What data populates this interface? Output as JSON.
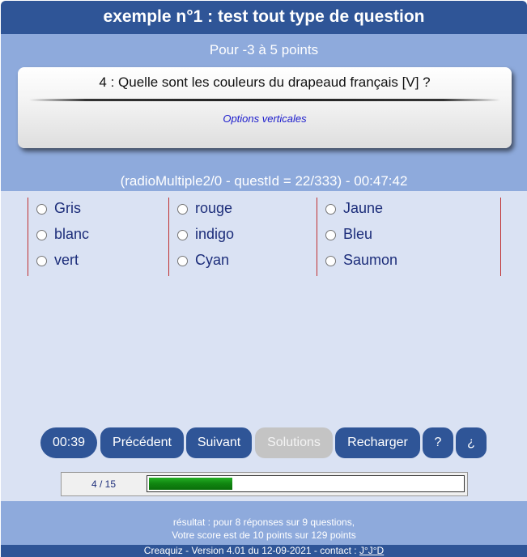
{
  "header": {
    "title": "exemple n°1 : test tout type de question"
  },
  "points": "Pour -3 à 5 points",
  "question": {
    "text": "4 : Quelle sont les couleurs du drapeaud français [V] ?",
    "option_note": "Options verticales"
  },
  "question_info": "(radioMultiple2/0 - questId = 22/333) - 00:47:42",
  "answers": {
    "col1": [
      "Gris",
      "blanc",
      "vert"
    ],
    "col2": [
      "rouge",
      "indigo",
      "Cyan"
    ],
    "col3": [
      "Jaune",
      "Bleu",
      "Saumon"
    ]
  },
  "buttons": {
    "timer": "00:39",
    "previous": "Précédent",
    "next": "Suivant",
    "solutions": "Solutions",
    "reload": "Recharger",
    "help": "?",
    "about": "¿"
  },
  "progress": {
    "label": "4 / 15",
    "fraction": 0.2667
  },
  "result": {
    "line1": "résultat : pour 8 réponses sur 9 questions,",
    "line2": "Votre score est de 10 points sur 129 points"
  },
  "footer": {
    "version": "Creaquiz - Version 4.01 du 12-09-2021 - contact :",
    "contact": "J°J°D"
  },
  "colors": {
    "primary": "#2f5597",
    "band": "#8eaadc",
    "answers_bg": "#dae2f3",
    "disabled": "#c4c4c4",
    "progress": "#118811"
  }
}
